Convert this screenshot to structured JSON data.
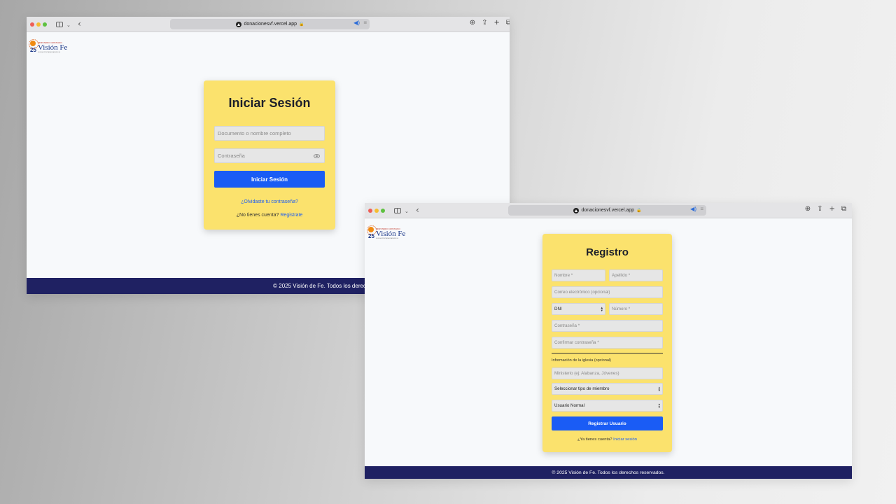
{
  "browser": {
    "url": "donacionesvf.vercel.app"
  },
  "logo": {
    "top_text": "MINISTERIO CRISTIANO",
    "main_text": "Visión Fe",
    "anniversary": "25",
    "subtitle": "IGLESIA CRISTIANA EVANGÉLICA"
  },
  "login": {
    "title": "Iniciar Sesión",
    "document_placeholder": "Documento o nombre completo",
    "password_placeholder": "Contraseña",
    "submit_label": "Iniciar Sesión",
    "forgot_link": "¿Olvidaste tu contraseña?",
    "no_account_text": "¿No tienes cuenta?",
    "register_link": "Registrate"
  },
  "register": {
    "title": "Registro",
    "first_name_placeholder": "Nombre *",
    "last_name_placeholder": "Apellido *",
    "email_placeholder": "Correo electrónico (opcional)",
    "doc_type_selected": "DNI",
    "number_placeholder": "Número *",
    "password_placeholder": "Contraseña *",
    "confirm_password_placeholder": "Confirmar contraseña *",
    "church_section_label": "Información de la iglesia (opcional)",
    "ministry_placeholder": "Ministerio (ej: Alabanza, Jóvenes)",
    "member_type_selected": "Seleccionar tipo de miembro",
    "user_type_selected": "Usuario Normal",
    "submit_label": "Registrar Usuario",
    "have_account_text": "¿Ya tienes cuenta?",
    "login_link": "Iniciar sesión"
  },
  "footer": {
    "text": "© 2025 Visión de Fe. Todos los derechos reservados."
  },
  "colors": {
    "card_yellow": "#fbe26d",
    "button_blue": "#1a5cf5",
    "footer_navy": "#1f2162",
    "page_bg": "#f7f9fb"
  },
  "icons": [
    "sidebar-toggle-icon",
    "back-arrow-icon",
    "site-favicon-icon",
    "lock-icon",
    "speaker-icon",
    "reader-icon",
    "download-icon",
    "share-icon",
    "new-tab-icon",
    "tabs-overview-icon",
    "show-password-icon",
    "select-arrow-icon"
  ]
}
